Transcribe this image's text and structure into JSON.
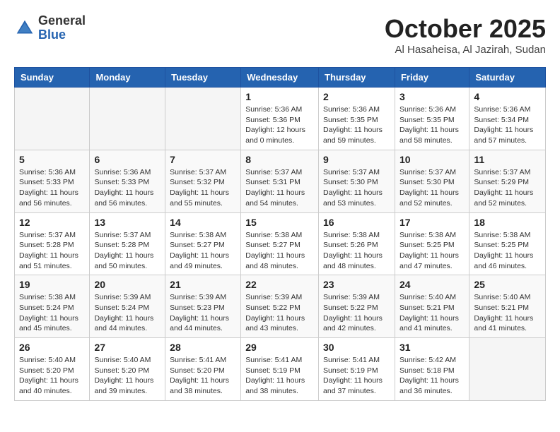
{
  "logo": {
    "general": "General",
    "blue": "Blue"
  },
  "title": "October 2025",
  "subtitle": "Al Hasaheisa, Al Jazirah, Sudan",
  "days_of_week": [
    "Sunday",
    "Monday",
    "Tuesday",
    "Wednesday",
    "Thursday",
    "Friday",
    "Saturday"
  ],
  "weeks": [
    [
      {
        "day": "",
        "info": ""
      },
      {
        "day": "",
        "info": ""
      },
      {
        "day": "",
        "info": ""
      },
      {
        "day": "1",
        "info": "Sunrise: 5:36 AM\nSunset: 5:36 PM\nDaylight: 12 hours\nand 0 minutes."
      },
      {
        "day": "2",
        "info": "Sunrise: 5:36 AM\nSunset: 5:35 PM\nDaylight: 11 hours\nand 59 minutes."
      },
      {
        "day": "3",
        "info": "Sunrise: 5:36 AM\nSunset: 5:35 PM\nDaylight: 11 hours\nand 58 minutes."
      },
      {
        "day": "4",
        "info": "Sunrise: 5:36 AM\nSunset: 5:34 PM\nDaylight: 11 hours\nand 57 minutes."
      }
    ],
    [
      {
        "day": "5",
        "info": "Sunrise: 5:36 AM\nSunset: 5:33 PM\nDaylight: 11 hours\nand 56 minutes."
      },
      {
        "day": "6",
        "info": "Sunrise: 5:36 AM\nSunset: 5:33 PM\nDaylight: 11 hours\nand 56 minutes."
      },
      {
        "day": "7",
        "info": "Sunrise: 5:37 AM\nSunset: 5:32 PM\nDaylight: 11 hours\nand 55 minutes."
      },
      {
        "day": "8",
        "info": "Sunrise: 5:37 AM\nSunset: 5:31 PM\nDaylight: 11 hours\nand 54 minutes."
      },
      {
        "day": "9",
        "info": "Sunrise: 5:37 AM\nSunset: 5:30 PM\nDaylight: 11 hours\nand 53 minutes."
      },
      {
        "day": "10",
        "info": "Sunrise: 5:37 AM\nSunset: 5:30 PM\nDaylight: 11 hours\nand 52 minutes."
      },
      {
        "day": "11",
        "info": "Sunrise: 5:37 AM\nSunset: 5:29 PM\nDaylight: 11 hours\nand 52 minutes."
      }
    ],
    [
      {
        "day": "12",
        "info": "Sunrise: 5:37 AM\nSunset: 5:28 PM\nDaylight: 11 hours\nand 51 minutes."
      },
      {
        "day": "13",
        "info": "Sunrise: 5:37 AM\nSunset: 5:28 PM\nDaylight: 11 hours\nand 50 minutes."
      },
      {
        "day": "14",
        "info": "Sunrise: 5:38 AM\nSunset: 5:27 PM\nDaylight: 11 hours\nand 49 minutes."
      },
      {
        "day": "15",
        "info": "Sunrise: 5:38 AM\nSunset: 5:27 PM\nDaylight: 11 hours\nand 48 minutes."
      },
      {
        "day": "16",
        "info": "Sunrise: 5:38 AM\nSunset: 5:26 PM\nDaylight: 11 hours\nand 48 minutes."
      },
      {
        "day": "17",
        "info": "Sunrise: 5:38 AM\nSunset: 5:25 PM\nDaylight: 11 hours\nand 47 minutes."
      },
      {
        "day": "18",
        "info": "Sunrise: 5:38 AM\nSunset: 5:25 PM\nDaylight: 11 hours\nand 46 minutes."
      }
    ],
    [
      {
        "day": "19",
        "info": "Sunrise: 5:38 AM\nSunset: 5:24 PM\nDaylight: 11 hours\nand 45 minutes."
      },
      {
        "day": "20",
        "info": "Sunrise: 5:39 AM\nSunset: 5:24 PM\nDaylight: 11 hours\nand 44 minutes."
      },
      {
        "day": "21",
        "info": "Sunrise: 5:39 AM\nSunset: 5:23 PM\nDaylight: 11 hours\nand 44 minutes."
      },
      {
        "day": "22",
        "info": "Sunrise: 5:39 AM\nSunset: 5:22 PM\nDaylight: 11 hours\nand 43 minutes."
      },
      {
        "day": "23",
        "info": "Sunrise: 5:39 AM\nSunset: 5:22 PM\nDaylight: 11 hours\nand 42 minutes."
      },
      {
        "day": "24",
        "info": "Sunrise: 5:40 AM\nSunset: 5:21 PM\nDaylight: 11 hours\nand 41 minutes."
      },
      {
        "day": "25",
        "info": "Sunrise: 5:40 AM\nSunset: 5:21 PM\nDaylight: 11 hours\nand 41 minutes."
      }
    ],
    [
      {
        "day": "26",
        "info": "Sunrise: 5:40 AM\nSunset: 5:20 PM\nDaylight: 11 hours\nand 40 minutes."
      },
      {
        "day": "27",
        "info": "Sunrise: 5:40 AM\nSunset: 5:20 PM\nDaylight: 11 hours\nand 39 minutes."
      },
      {
        "day": "28",
        "info": "Sunrise: 5:41 AM\nSunset: 5:20 PM\nDaylight: 11 hours\nand 38 minutes."
      },
      {
        "day": "29",
        "info": "Sunrise: 5:41 AM\nSunset: 5:19 PM\nDaylight: 11 hours\nand 38 minutes."
      },
      {
        "day": "30",
        "info": "Sunrise: 5:41 AM\nSunset: 5:19 PM\nDaylight: 11 hours\nand 37 minutes."
      },
      {
        "day": "31",
        "info": "Sunrise: 5:42 AM\nSunset: 5:18 PM\nDaylight: 11 hours\nand 36 minutes."
      },
      {
        "day": "",
        "info": ""
      }
    ]
  ]
}
